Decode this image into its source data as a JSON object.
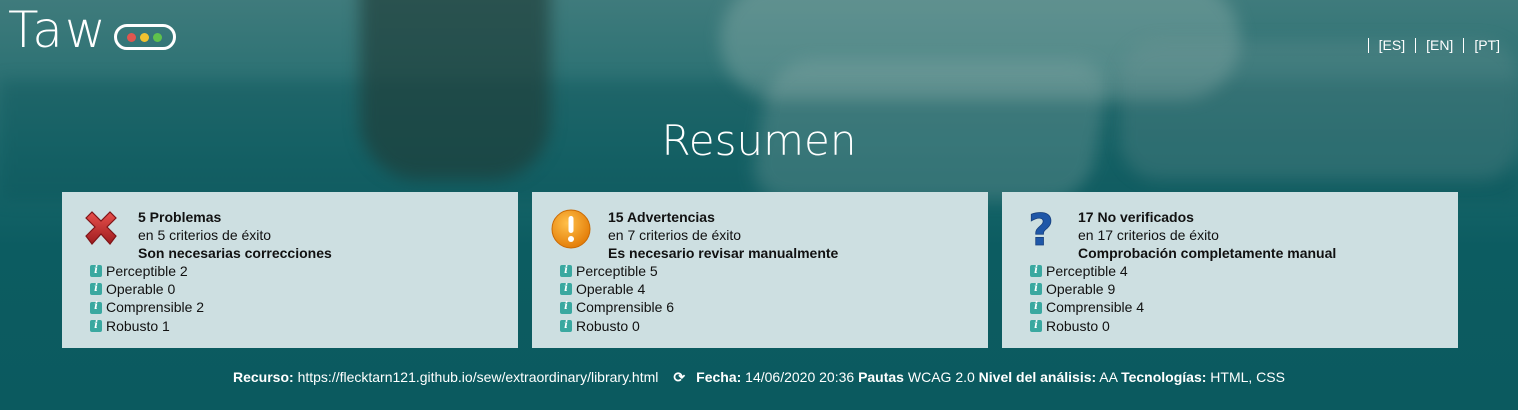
{
  "header": {
    "logo_text": "Taw",
    "languages": [
      "[ES]",
      "[EN]",
      "[PT]"
    ]
  },
  "title": "Resumen",
  "cards": [
    {
      "icon": "error-x-icon",
      "count_label": "5 Problemas",
      "criteria": "en 5 criterios de éxito",
      "note": "Son necesarias correcciones",
      "items": [
        "Perceptible 2",
        "Operable 0",
        "Comprensible 2",
        "Robusto 1"
      ]
    },
    {
      "icon": "warning-icon",
      "count_label": "15 Advertencias",
      "criteria": "en 7 criterios de éxito",
      "note": "Es necesario revisar manualmente",
      "items": [
        "Perceptible 5",
        "Operable 4",
        "Comprensible 6",
        "Robusto 0"
      ]
    },
    {
      "icon": "question-icon",
      "count_label": "17 No verificados",
      "criteria": "en 17 criterios de éxito",
      "note": "Comprobación completamente manual",
      "items": [
        "Perceptible 4",
        "Operable 9",
        "Comprensible 4",
        "Robusto 0"
      ]
    }
  ],
  "footer": {
    "resource_label": "Recurso:",
    "resource_value": "https://flecktarn121.github.io/sew/extraordinary/library.html",
    "date_label": "Fecha:",
    "date_value": "14/06/2020 20:36",
    "guidelines_label": "Pautas",
    "guidelines_value": "WCAG 2.0",
    "level_label": "Nivel del análisis:",
    "level_value": "AA",
    "tech_label": "Tecnologías:",
    "tech_value": "HTML, CSS"
  },
  "colors": {
    "card_bg": "#cddfe1",
    "info_icon": "#3aa8a0",
    "error_red": "#c0262b",
    "warning_orange": "#f08c12",
    "question_blue": "#1f57a8"
  }
}
